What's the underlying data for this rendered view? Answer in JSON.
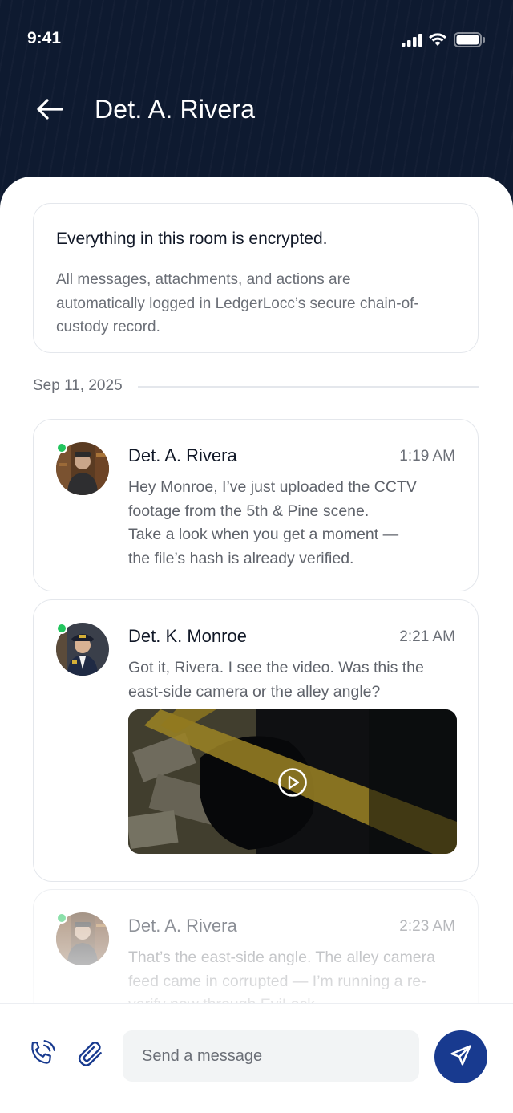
{
  "status_bar": {
    "time": "9:41",
    "icons": [
      "signal-icon",
      "wifi-icon",
      "battery-icon"
    ]
  },
  "header": {
    "back_icon": "arrow-left-icon",
    "title": "Det. A. Rivera",
    "background_color": "#0e1a30"
  },
  "banner": {
    "title": "Everything in this room is encrypted.",
    "body": "All messages, attachments, and actions are automatically logged in LedgerLocc’s secure chain-of-custody record."
  },
  "date_separator": "Sep 11, 2025",
  "messages": [
    {
      "sender": "Det. A. Rivera",
      "time": "1:19 AM",
      "online": true,
      "text": "Hey Monroe, I’ve just uploaded the CCTV footage from the 5th & Pine scene.\n Take a look when you get a moment —\nthe file’s hash is already verified."
    },
    {
      "sender": "Det. K. Monroe",
      "time": "2:21 AM",
      "online": true,
      "text": "Got it, Rivera. I see the video. Was this the east-side camera or the alley angle?",
      "attachment": {
        "type": "video",
        "icon": "play-circle-icon"
      }
    },
    {
      "sender": "Det. A. Rivera",
      "time": "2:23 AM",
      "online": true,
      "text": "That’s the east-side angle. The alley camera feed came in corrupted — I’m running a re-verify now through EviLock."
    }
  ],
  "composer": {
    "call_icon": "phone-call-icon",
    "attach_icon": "paperclip-icon",
    "placeholder": "Send a message",
    "send_icon": "send-icon"
  },
  "colors": {
    "accent": "#183a8f",
    "online": "#22c55e",
    "border": "#e4e7ec",
    "muted_text": "#6b6f77"
  }
}
